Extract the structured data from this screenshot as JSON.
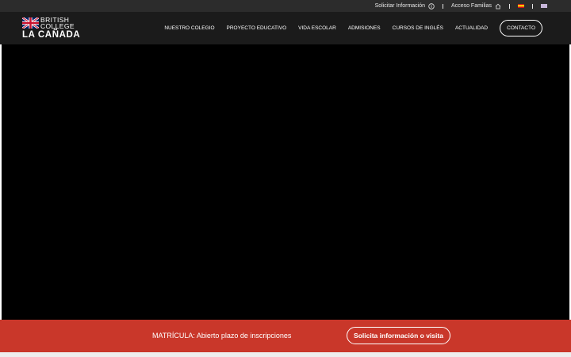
{
  "topbar": {
    "request_info": "Solicitar Información",
    "family_access": "Acceso Familias",
    "languages": [
      {
        "code": "es",
        "icon": "spain-flag-icon"
      },
      {
        "code": "en",
        "icon": "uk-flag-icon"
      }
    ]
  },
  "logo": {
    "line1": "BRITISH",
    "line2": "COLLEGE",
    "line3": "LA CAÑADA",
    "icon": "union-jack-icon"
  },
  "nav": {
    "items": [
      {
        "label": "NUESTRO COLEGIO"
      },
      {
        "label": "PROYECTO EDUCATIVO"
      },
      {
        "label": "VIDA ESCOLAR"
      },
      {
        "label": "ADMISIONES"
      },
      {
        "label": "CURSOS DE INGLÉS"
      },
      {
        "label": "ACTUALIDAD"
      }
    ],
    "contact": "CONTACTO"
  },
  "banner": {
    "text": "MATRÍCULA: Abierto plazo de inscripciones",
    "button": "Solicita información o visita"
  },
  "colors": {
    "topbar_bg": "#2c2c2c",
    "navbar_bg": "#1b1b1b",
    "hero_bg": "#000000",
    "banner_bg": "#c9372a"
  }
}
